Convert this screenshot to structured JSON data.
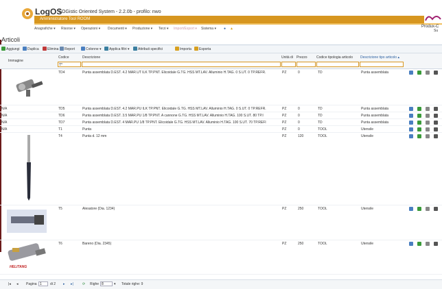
{
  "header": {
    "app_name": "LogOS",
    "app_subtitle": "LOGistic Oriented System - 2.2.0b - profilo: nwo",
    "admin_title": "Amministratore Tool ROOM",
    "brand_text": "Produx-C",
    "brand_sub": "Su",
    "accent_color": "#d7961f"
  },
  "menu": [
    {
      "label": "Anagrafiche ▾",
      "disabled": false
    },
    {
      "label": "Risorse ▾",
      "disabled": false
    },
    {
      "label": "Operazioni ▾",
      "disabled": false
    },
    {
      "label": "Documenti ▾",
      "disabled": false
    },
    {
      "label": "Produzione ▾",
      "disabled": false
    },
    {
      "label": "Terzi ▾",
      "disabled": false
    },
    {
      "label": "Import/Export ▾",
      "disabled": true
    },
    {
      "label": "Sistema ▾",
      "disabled": false
    }
  ],
  "page_title": "Articoli",
  "toolbar": [
    {
      "label": "Aggiungi",
      "icon": "add-icon",
      "color": "#3a9a3a"
    },
    {
      "label": "Duplica",
      "icon": "duplicate-icon",
      "color": "#4a7fc0"
    },
    {
      "label": "Elimina",
      "icon": "delete-icon",
      "color": "#c03a3a"
    },
    {
      "label": "Report",
      "icon": "report-icon",
      "color": "#6a8ab0"
    },
    {
      "label": "Colonne ▾",
      "icon": "columns-icon",
      "color": "#4a7fc0"
    },
    {
      "label": "Applica filtri ▾",
      "icon": "filter-icon",
      "color": "#3a7fa0"
    },
    {
      "label": "Attributi specifici",
      "icon": "filter-icon",
      "color": "#3a7fa0"
    },
    {
      "label": "Importa",
      "icon": "import-icon",
      "color": "#d7a020"
    },
    {
      "label": "Esporta",
      "icon": "export-icon",
      "color": "#d7a020"
    }
  ],
  "columns": {
    "immagine": "Immagine",
    "codice": "Codice",
    "descrizione": "Descrizione",
    "unita": "Unità di",
    "prezzo": "Prezzo",
    "codice_tipologia": "Codice tipologia articolo",
    "descrizione_tipo": "Descrizione tipo articolo ▴"
  },
  "filters": {
    "codice": "T*"
  },
  "rows": [
    {
      "img": "",
      "codice": "TD4",
      "descrizione": "Punta assemblata D.EST. 4.2 MAR.UT ILK TP.PNT. Elicoidale G.TG. HSS MT.LAV. Alluminio H.TAG. 0 S.UT. 0 TP.REFR.",
      "unita": "PZ",
      "prezzo": "0",
      "tipologia": "TD",
      "tipo": "Punta assemblata",
      "image": "reamer"
    },
    {
      "img": "N/A",
      "codice": "TD5",
      "descrizione": "Punta assemblata D.EST. 4.2 MAR.PU ILK TP.PNT. Elicoidale G.TG. HSS MT.LAV. Alluminio H.TAG. 0 S.UT. 0 TP.REFR.",
      "unita": "PZ",
      "prezzo": "0",
      "tipologia": "TD",
      "tipo": "Punta assemblata",
      "image": ""
    },
    {
      "img": "N/A",
      "codice": "TD6",
      "descrizione": "Punta assemblata D.EST. 3.5 MAR.PU 1/8 TP.PNT. A cannone G.TG. HSS MT.LAV. Alluminio H.TAG. 100 S.UT. 80 TP.I",
      "unita": "PZ",
      "prezzo": "0",
      "tipologia": "TD",
      "tipo": "Punta assemblata",
      "image": ""
    },
    {
      "img": "N/A",
      "codice": "TD7",
      "descrizione": "Punta assemblata D.EST. 4 MAR.PU 1/8 TP.PNT. Elicoidale G.TG. HSS MT.LAV. Alluminio H.TAG. 100 S.UT. 70 TP.REFI",
      "unita": "PZ",
      "prezzo": "0",
      "tipologia": "TD",
      "tipo": "Punta assemblata",
      "image": ""
    },
    {
      "img": "N/A",
      "codice": "T1",
      "descrizione": "Punta",
      "unita": "PZ",
      "prezzo": "0",
      "tipologia": "TOOL",
      "tipo": "Utensile",
      "image": ""
    },
    {
      "img": "",
      "codice": "T4",
      "descrizione": "Punta d. 12 mm",
      "unita": "PZ",
      "prezzo": "120",
      "tipologia": "TOOL",
      "tipo": "Utensile",
      "image": "drill"
    },
    {
      "img": "",
      "codice": "T5",
      "descrizione": "Alesatore (Dia. 1234)",
      "unita": "PZ",
      "prezzo": "250",
      "tipologia": "TOOL",
      "tipo": "Utensile",
      "image": "reamer2"
    },
    {
      "img": "",
      "codice": "T6",
      "descrizione": "Bareno (Dia. 2345)",
      "unita": "PZ",
      "prezzo": "250",
      "tipologia": "TOOL",
      "tipo": "Utensile",
      "image": "boring",
      "logo": "HELITANG"
    }
  ],
  "pager": {
    "page_label": "Pagina",
    "page_value": "1",
    "of_label": "di 2",
    "rows_label": "Righe",
    "rows_value": "8",
    "total_label": "Totale righe: 9"
  }
}
